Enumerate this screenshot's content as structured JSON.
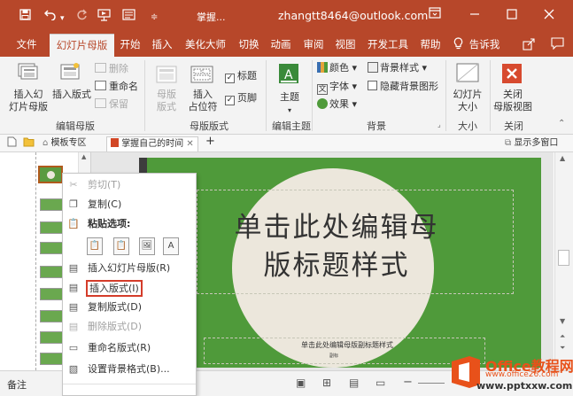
{
  "titlebar": {
    "doc_title": "掌握...",
    "account": "zhangtt8464@outlook.com",
    "icons": [
      "save-icon",
      "undo-icon",
      "redo-icon",
      "present-icon",
      "slides-icon",
      "ribbon-display-icon",
      "minimize-icon",
      "restore-icon",
      "close-icon"
    ]
  },
  "tabs": [
    {
      "label": "文件"
    },
    {
      "label": "幻灯片母版"
    },
    {
      "label": "开始"
    },
    {
      "label": "插入"
    },
    {
      "label": "美化大师"
    },
    {
      "label": "切换"
    },
    {
      "label": "动画"
    },
    {
      "label": "审阅"
    },
    {
      "label": "视图"
    },
    {
      "label": "开发工具"
    },
    {
      "label": "帮助"
    },
    {
      "label": "告诉我"
    }
  ],
  "ribbon": {
    "insert_master": "插入幻\n灯片母版",
    "insert_layout": "插入版式",
    "delete": "删除",
    "rename": "重命名",
    "preserve": "保留",
    "group_edit_master": "编辑母版",
    "master_layout": "母版\n版式",
    "insert_placeholder": "插入\n占位符",
    "title_check": "标题",
    "footer_check": "页脚",
    "group_master_layout": "母版版式",
    "themes": "主题",
    "group_edit_theme": "编辑主题",
    "colors": "颜色",
    "fonts": "字体",
    "effects": "效果",
    "bg_styles": "背景样式",
    "hide_bg": "隐藏背景图形",
    "group_background": "背景",
    "slide_size": "幻灯片\n大小",
    "group_size": "大小",
    "close_master": "关闭\n母版视图",
    "group_close": "关闭"
  },
  "doctabs": {
    "templates": "模板专区",
    "current": "掌握自己的时间",
    "show_windows": "显示多窗口"
  },
  "slide": {
    "title": "单击此处编辑母\n版标题样式",
    "subtitle": "单击此处编辑母版副标题样式",
    "subtitle_small": "副标"
  },
  "context_menu": {
    "cut": "剪切(T)",
    "copy": "复制(C)",
    "paste_options": "粘贴选项:",
    "insert_master": "插入幻灯片母版(R)",
    "insert_layout": "插入版式(I)",
    "duplicate_layout": "复制版式(D)",
    "delete_layout": "删除版式(D)",
    "rename_layout": "重命名版式(R)",
    "format_background": "设置背景格式(B)..."
  },
  "status": {
    "notes": "备注"
  },
  "watermark": {
    "brand": "Office教程网",
    "url": "www.pptxxw.com",
    "url_alt": "www.office26.com"
  },
  "colors": {
    "accent": "#b7472a",
    "slide_bg": "#4f9a3a",
    "seal": "#ece7dc",
    "highlight_box": "#d43c2a"
  }
}
